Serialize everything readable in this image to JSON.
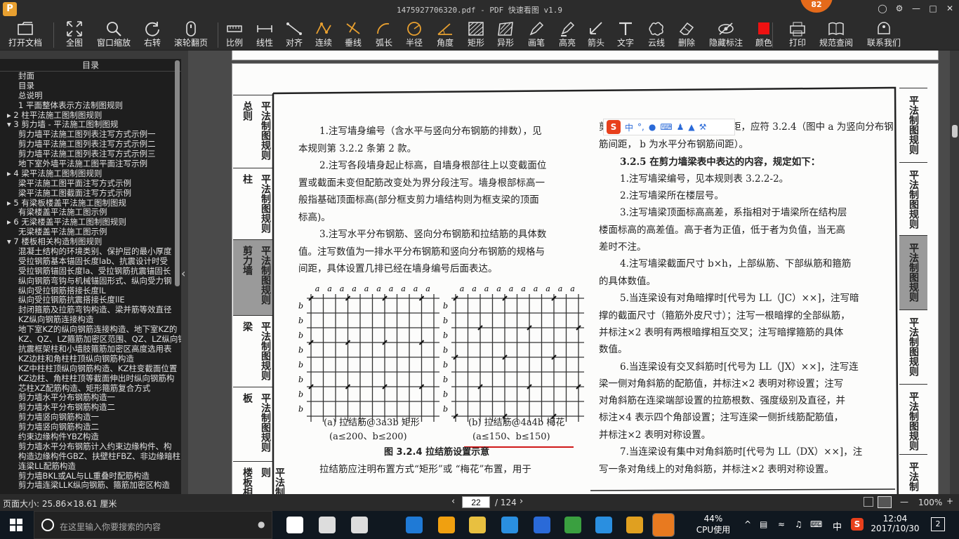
{
  "window": {
    "title": "1475927706320.pdf - PDF 快速看图 v1.9",
    "badge": "82",
    "app_icon_letter": "P"
  },
  "toolbar": [
    {
      "key": "open",
      "label": "打开文档"
    },
    {
      "key": "full",
      "label": "全图"
    },
    {
      "key": "zoom",
      "label": "窗口缩放"
    },
    {
      "key": "rotate",
      "label": "右转"
    },
    {
      "key": "scroll",
      "label": "滚轮翻页"
    },
    {
      "key": "scale",
      "label": "比例"
    },
    {
      "key": "linear",
      "label": "线性"
    },
    {
      "key": "align",
      "label": "对齐"
    },
    {
      "key": "cont",
      "label": "连续"
    },
    {
      "key": "perp",
      "label": "垂线"
    },
    {
      "key": "arc",
      "label": "弧长"
    },
    {
      "key": "radius",
      "label": "半径"
    },
    {
      "key": "angle",
      "label": "角度"
    },
    {
      "key": "rect",
      "label": "矩形"
    },
    {
      "key": "shape",
      "label": "异形"
    },
    {
      "key": "pen",
      "label": "画笔"
    },
    {
      "key": "highlight",
      "label": "高亮"
    },
    {
      "key": "arrow",
      "label": "箭头"
    },
    {
      "key": "text",
      "label": "文字"
    },
    {
      "key": "cloud",
      "label": "云线"
    },
    {
      "key": "delete",
      "label": "删除"
    },
    {
      "key": "hide",
      "label": "隐藏标注"
    },
    {
      "key": "color",
      "label": "颜色"
    },
    {
      "key": "print",
      "label": "打印"
    },
    {
      "key": "spec",
      "label": "规范查阅"
    },
    {
      "key": "contact",
      "label": "联系我们"
    }
  ],
  "sidebar": {
    "title": "目录",
    "items": [
      "封面",
      "目录",
      "总说明",
      "1 平面整体表示方法制图规则",
      "▸ 2 柱平法施工图制图规则",
      "▾ 3 剪力墙 - 平法施工图制图规",
      "剪力墙平法施工图列表注写方式示例一",
      "剪力墙平法施工图列表注写方式示例二",
      "剪力墙平法施工图列表注写方式示例三",
      "地下室外墙平法施工图平面注写示例",
      "▸ 4 梁平法施工图制图规则",
      "梁平法施工图平面注写方式示例",
      "梁平法施工图截面注写方式示例",
      "▸ 5 有梁板楼盖平法施工图制图规",
      "有梁楼盖平法施工图示例",
      "▸ 6 无梁楼盖平法施工图制图规则",
      "无梁楼盖平法施工图示例",
      "▾ 7 楼板相关构造制图规则",
      "混凝土结构的环境类别、保护层的最小厚度",
      "受拉钢筋基本锚固长度lab、抗震设计时受",
      "受拉钢筋锚固长度la、受拉钢筋抗震锚固长",
      "纵向钢筋弯钩与机械锚固形式、纵向受力钢",
      "纵向受拉钢筋搭接长度lL",
      "纵向受拉钢筋抗震搭接长度llE",
      "封闭箍筋及拉筋弯钩构造、梁并筋等效直径",
      "KZ纵向钢筋连接构造",
      "地下室KZ的纵向钢筋连接构造、地下室KZ的",
      "KZ、QZ、LZ箍筋加密区范围、QZ、LZ纵向钢",
      "抗震框架柱和小墙肢箍筋加密区高度选用表",
      "KZ边柱和角柱柱顶纵向钢筋构造",
      "KZ中柱柱顶纵向钢筋构造、KZ柱变截面位置",
      "KZ边柱、角柱柱顶等截面伸出时纵向钢筋构",
      "芯柱XZ配筋构造、矩形箍筋复合方式",
      "剪力墙水平分布钢筋构造一",
      "剪力墙水平分布钢筋构造二",
      "剪力墙竖向钢筋构造一",
      "剪力墙竖向钢筋构造二",
      "约束边缘构件YBZ构造",
      "剪力墙水平分布钢筋计入约束边缘构件、构",
      "构造边缘构件GBZ、扶壁柱FBZ、非边缘暗柱",
      "连梁LL配筋构造",
      "剪力墙BKL或AL与LL重叠时配筋构造",
      "剪力墙连梁LLK纵向钢筋、箍筋加密区构造"
    ]
  },
  "doc": {
    "left_tabs": [
      "总则",
      "柱",
      "剪力墙",
      "梁",
      "板",
      "楼板相"
    ],
    "tab_vertical": "平法制图规则",
    "right_tabs": [
      "平法制图规则",
      "平法制图规则",
      "平法制图规则",
      "平法制图规则",
      "平法制图规则",
      "平法制"
    ],
    "left_lines": [
      "1.注写墙身编号（含水平与竖向分布钢筋的排数），见",
      "本规则第 3.2.2 条第 2 款。",
      "2.注写各段墙身起止标高，自墙身根部往上以变截面位",
      "置或截面未变但配筋改变处为界分段注写。墙身根部标高一",
      "般指基础顶面标高(部分框支剪力墙结构则为框支梁的顶面",
      "标高)。",
      "3.注写水平分布钢筋、竖向分布钢筋和拉结筋的具体数",
      "值。注写数值为一排水平分布钢筋和竖向分布钢筋的规格与",
      "间距，具体设置几排已经在墙身编号后面表达。"
    ],
    "fig_a_caption1": "(a) 拉结筋@3a3b 矩形",
    "fig_a_caption2": "(a≤200、b≤200)",
    "fig_b_caption1": "(b) 拉结筋@4a4b 梅花",
    "fig_b_caption2": "(a≤150、b≤150)",
    "fig_title": "图 3.2.4 拉结筋设置示意",
    "bottom_line": "拉结筋应注明布置方式“矩形”或 “梅花”布置，用于",
    "grid_label_a": "a",
    "grid_label_b": "b",
    "right_lines": [
      "剪力墙身时，应注明拉结筋的间距，应符 3.2.4（图中 a 为竖向分布钢",
      "筋间距，  b 为水平分布钢筋间距）。",
      "3.2.5  在剪力墙梁表中表达的内容，规定如下：",
      "1.注写墙梁编号，见本规则表 3.2.2-2。",
      "2.注写墙梁所在楼层号。",
      "3.注写墙梁顶面标高高差，系指相对于墙梁所在结构层",
      "楼面标高的高差值。高于者为正值，低于者为负值，当无高",
      "差时不注。",
      "4.注写墙梁截面尺寸 b×h，上部纵筋、下部纵筋和箍筋",
      "的具体数值。",
      "5.当连梁设有对角暗撑时[代号为 LL（JC）××]，注写暗",
      "撑的截面尺寸（箍筋外皮尺寸）；注写一根暗撑的全部纵筋，",
      "并标注×2 表明有两根暗撑相互交叉；注写暗撑箍筋的具体",
      "数值。",
      "6.当连梁设有交叉斜筋时[代号为 LL（JX）××]，注写连",
      "梁一侧对角斜筋的配筋值，并标注×2 表明对称设置；注写",
      "对角斜筋在连梁端部设置的拉筋根数、强度级别及直径，并",
      "标注×4 表示四个角部设置；注写连梁一侧折线筋配筋值，",
      "并标注×2 表明对称设置。",
      "7.当连梁设有集中对角斜筋时[代号为 LL（DX）××]，注",
      "写一条对角线上的对角斜筋，并标注×2 表明对称设置。"
    ],
    "ime_label": "中"
  },
  "status": {
    "page_size": "页面大小: 25.86×18.61 厘米",
    "page": "22",
    "total": "/ 124",
    "zoom": "100%"
  },
  "taskbar": {
    "search_placeholder": "在这里输入你要搜索的内容",
    "cpu": "44%",
    "cpu_label": "CPU使用",
    "time": "12:04",
    "date": "2017/10/30",
    "lang": "中",
    "notif": "2"
  },
  "chart_data": [
    {
      "type": "scatter",
      "title": "(a) 拉结筋@3a3b 矩形",
      "description_visible": "(a≤200、b≤200)",
      "grid_cols": 10,
      "grid_rows": 8,
      "xlabel": "a",
      "ylabel": "b",
      "pattern": "rectangular every 3 cols × 3 rows"
    },
    {
      "type": "scatter",
      "title": "(b) 拉结筋@4a4b 梅花",
      "description_visible": "(a≤150、b≤150)",
      "grid_cols": 10,
      "grid_rows": 8,
      "xlabel": "a",
      "ylabel": "b",
      "pattern": "staggered every 4 cols × 4 rows"
    }
  ],
  "colors": {
    "toolbar_bg": "#2c2c2c",
    "accent_gold": "#e8a030",
    "highlight_red": "#d01818",
    "gray_tab": "#9a9a9a"
  }
}
